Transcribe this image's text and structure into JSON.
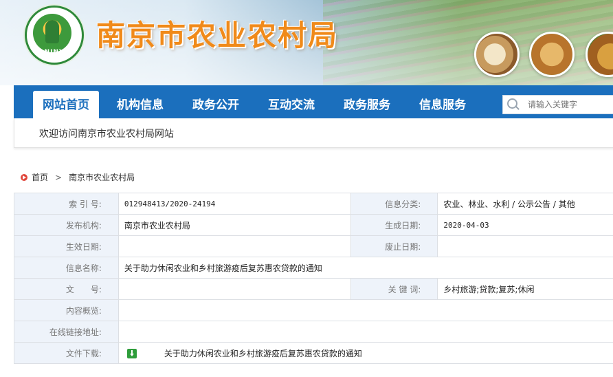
{
  "header": {
    "site_title": "南京市农业农村局",
    "logo_text": "NJNY"
  },
  "nav": {
    "items": [
      {
        "label": "网站首页",
        "active": true
      },
      {
        "label": "机构信息"
      },
      {
        "label": "政务公开"
      },
      {
        "label": "互动交流"
      },
      {
        "label": "政务服务"
      },
      {
        "label": "信息服务"
      }
    ],
    "search_placeholder": "请输入关键字"
  },
  "welcome": "欢迎访问南京市农业农村局网站",
  "breadcrumb": {
    "home": "首页",
    "separator": ">",
    "current": "南京市农业农村局"
  },
  "info_table": {
    "index_label": "索 引 号:",
    "index_value": "012948413/2020-24194",
    "category_label": "信息分类:",
    "category_value": "农业、林业、水利 / 公示公告 / 其他",
    "publisher_label": "发布机构:",
    "publisher_value": "南京市农业农村局",
    "created_label": "生成日期:",
    "created_value": "2020-04-03",
    "effective_label": "生效日期:",
    "effective_value": "",
    "expire_label": "废止日期:",
    "expire_value": "",
    "name_label": "信息名称:",
    "name_value": "关于助力休闲农业和乡村旅游疫后复苏惠农贷款的通知",
    "docno_label": "文　　号:",
    "docno_value": "",
    "keywords_label": "关 键 词:",
    "keywords_value": "乡村旅游;贷款;复苏;休闲",
    "overview_label": "内容概览:",
    "overview_value": "",
    "link_label": "在线链接地址:",
    "link_value": "",
    "download_label": "文件下载:",
    "download_value": "关于助力休闲农业和乡村旅游疫后复苏惠农贷款的通知"
  },
  "colors": {
    "nav_blue": "#1b6fbd",
    "title_orange": "#f08a1a",
    "label_bg": "#eef3fa"
  }
}
